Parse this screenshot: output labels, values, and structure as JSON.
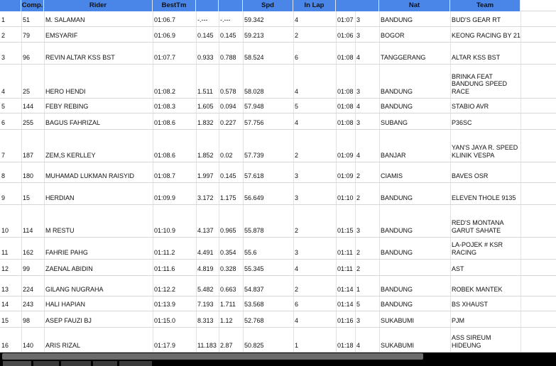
{
  "headers": [
    "",
    "Comp.",
    "Rider",
    "BestTm",
    "",
    "",
    "Spd",
    "In Lap",
    "",
    "Nat",
    "Team"
  ],
  "rows": [
    {
      "pos": "1",
      "comp": "51",
      "rider": "M. SALAMAN",
      "best": "01:06.7",
      "gap": "-.---",
      "diff": "-.---",
      "spd": "59.342",
      "inlap": "4",
      "time": "01:07",
      "lap": "3",
      "nat": "BANDUNG",
      "team": "BUD'S GEAR RT"
    },
    {
      "pos": "2",
      "comp": "79",
      "rider": "EMSYARIF",
      "best": "01:06.9",
      "gap": "0.145",
      "diff": "0.145",
      "spd": "59.213",
      "inlap": "2",
      "time": "01:06",
      "lap": "3",
      "nat": "BOGOR",
      "team": "KEONG RACING BY 21"
    },
    {
      "pos": "3",
      "comp": "96",
      "rider": "REVIN ALTAR KSS BST",
      "best": "01:07.7",
      "gap": "0.933",
      "diff": "0.788",
      "spd": "58.524",
      "inlap": "6",
      "time": "01:08",
      "lap": "4",
      "nat": "TANGGERANG",
      "team": "ALTAR KSS BST"
    },
    {
      "pos": "4",
      "comp": "25",
      "rider": "HERO HENDI",
      "best": "01:08.2",
      "gap": "1.511",
      "diff": "0.578",
      "spd": "58.028",
      "inlap": "4",
      "time": "01:08",
      "lap": "3",
      "nat": "BANDUNG",
      "team": "BRINKA FEAT BANDUNG SPEED RACE"
    },
    {
      "pos": "5",
      "comp": "144",
      "rider": "FEBY REBING",
      "best": "01:08.3",
      "gap": "1.605",
      "diff": "0.094",
      "spd": "57.948",
      "inlap": "5",
      "time": "01:08",
      "lap": "4",
      "nat": "BANDUNG",
      "team": "STABIO AVR"
    },
    {
      "pos": "6",
      "comp": "255",
      "rider": "BAGUS FAHRIZAL",
      "best": "01:08.6",
      "gap": "1.832",
      "diff": "0.227",
      "spd": "57.756",
      "inlap": "4",
      "time": "01:08",
      "lap": "3",
      "nat": "SUBANG",
      "team": "P36SC"
    },
    {
      "pos": "7",
      "comp": "187",
      "rider": "ZEM,S KERLLEY",
      "best": "01:08.6",
      "gap": "1.852",
      "diff": "0.02",
      "spd": "57.739",
      "inlap": "2",
      "time": "01:09",
      "lap": "4",
      "nat": "BANJAR",
      "team": "YAN'S JAYA R. SPEED KLINIK VESPA"
    },
    {
      "pos": "8",
      "comp": "180",
      "rider": "MUHAMAD LUKMAN RAISYID",
      "best": "01:08.7",
      "gap": "1.997",
      "diff": "0.145",
      "spd": "57.618",
      "inlap": "3",
      "time": "01:09",
      "lap": "2",
      "nat": "CIAMIS",
      "team": "BAVES OSR"
    },
    {
      "pos": "9",
      "comp": "15",
      "rider": "HERDIAN",
      "best": "01:09.9",
      "gap": "3.172",
      "diff": "1.175",
      "spd": "56.649",
      "inlap": "3",
      "time": "01:10",
      "lap": "2",
      "nat": "BANDUNG",
      "team": "ELEVEN THOLE 9135"
    },
    {
      "pos": "10",
      "comp": "114",
      "rider": "M RESTU",
      "best": "01:10.9",
      "gap": "4.137",
      "diff": "0.965",
      "spd": "55.878",
      "inlap": "2",
      "time": "01:15",
      "lap": "3",
      "nat": "BANDUNG",
      "team": "RED'S MONTANA GARUT SAHATE"
    },
    {
      "pos": "11",
      "comp": "162",
      "rider": "FAHRIE PAHG",
      "best": "01:11.2",
      "gap": "4.491",
      "diff": "0.354",
      "spd": "55.6",
      "inlap": "3",
      "time": "01:11",
      "lap": "2",
      "nat": "BANDUNG",
      "team": "LA-POJEK # KSR RACING"
    },
    {
      "pos": "12",
      "comp": "99",
      "rider": "ZAENAL ABIDIN",
      "best": "01:11.6",
      "gap": "4.819",
      "diff": "0.328",
      "spd": "55.345",
      "inlap": "4",
      "time": "01:11",
      "lap": "2",
      "nat": "",
      "team": "AST"
    },
    {
      "pos": "13",
      "comp": "224",
      "rider": "GILANG NUGRAHA",
      "best": "01:12.2",
      "gap": "5.482",
      "diff": "0.663",
      "spd": "54.837",
      "inlap": "2",
      "time": "01:14",
      "lap": "1",
      "nat": "BANDUNG",
      "team": "ROBEK MANTEK"
    },
    {
      "pos": "14",
      "comp": "243",
      "rider": "HALI HAPIAN",
      "best": "01:13.9",
      "gap": "7.193",
      "diff": "1.711",
      "spd": "53.568",
      "inlap": "6",
      "time": "01:14",
      "lap": "5",
      "nat": "BANDUNG",
      "team": "BS XHAUST"
    },
    {
      "pos": "15",
      "comp": "98",
      "rider": "ASEP FAUZI BJ",
      "best": "01:15.0",
      "gap": "8.313",
      "diff": "1.12",
      "spd": "52.768",
      "inlap": "4",
      "time": "01:16",
      "lap": "3",
      "nat": "SUKABUMI",
      "team": "PJM"
    },
    {
      "pos": "16",
      "comp": "140",
      "rider": "ARIS RIZAL",
      "best": "01:17.9",
      "gap": "11.183",
      "diff": "2.87",
      "spd": "50.825",
      "inlap": "1",
      "time": "01:18",
      "lap": "4",
      "nat": "SUKABUMI",
      "team": "ASS SIREUM HIDEUNG"
    }
  ]
}
